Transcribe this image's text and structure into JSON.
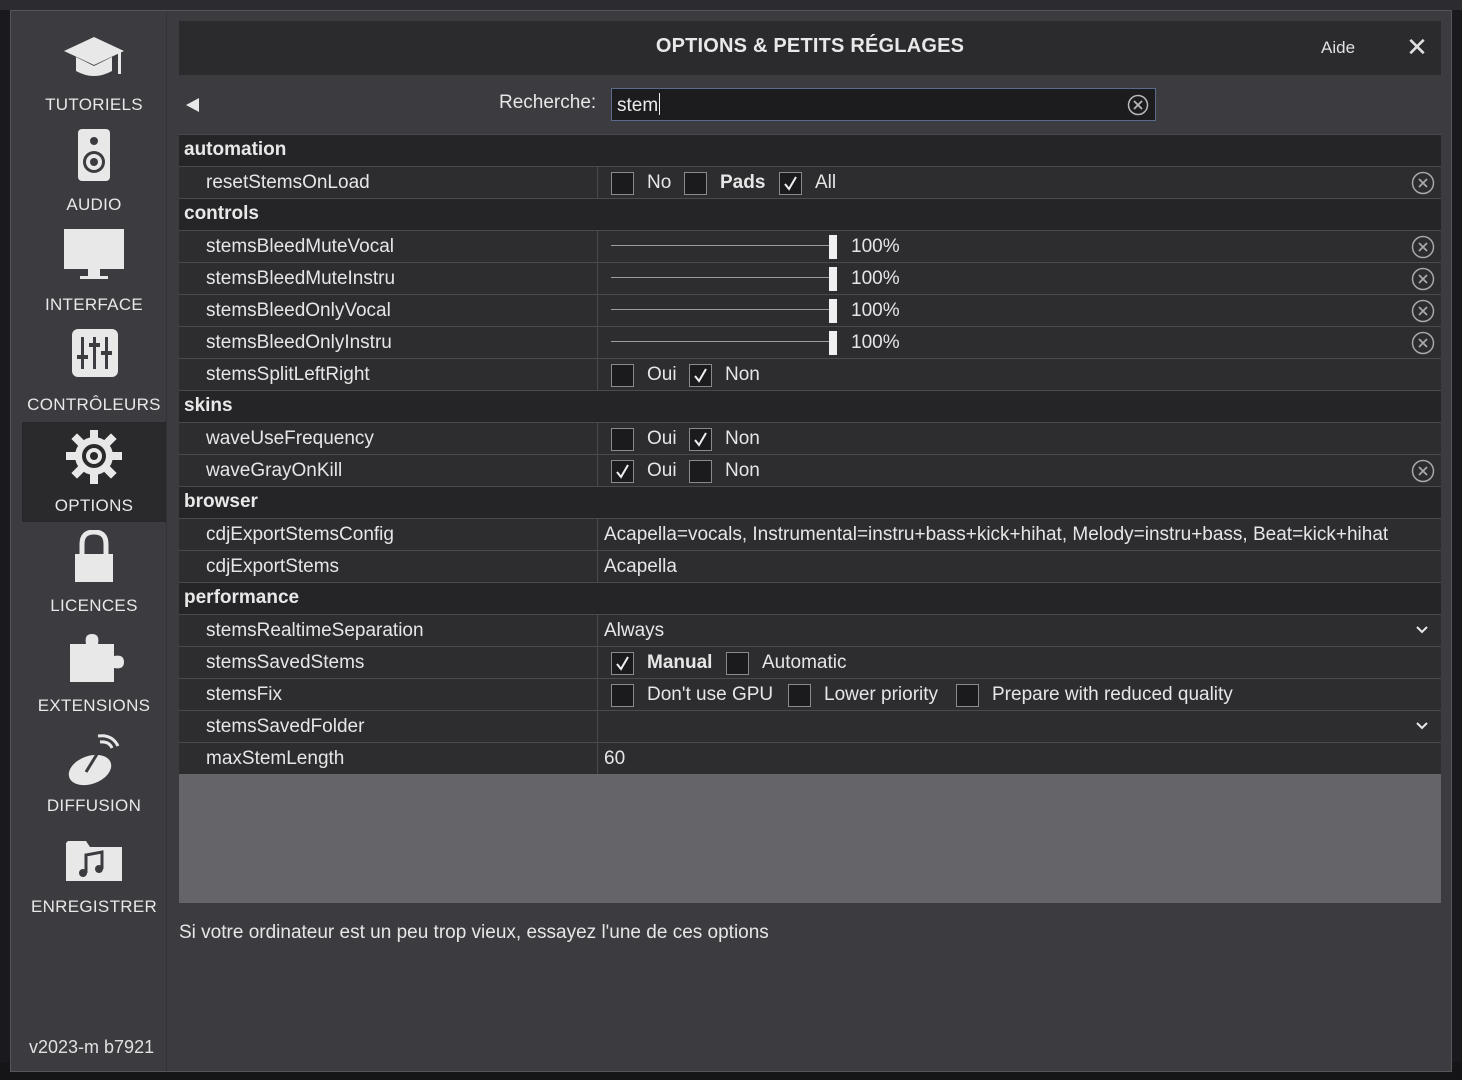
{
  "sidebar": {
    "items": [
      {
        "label": "TUTORIELS",
        "icon": "graduation-cap-icon"
      },
      {
        "label": "AUDIO",
        "icon": "speaker-icon"
      },
      {
        "label": "INTERFACE",
        "icon": "monitor-icon"
      },
      {
        "label": "CONTRÔLEURS",
        "icon": "mixer-sliders-icon"
      },
      {
        "label": "OPTIONS",
        "icon": "gear-icon",
        "active": true
      },
      {
        "label": "LICENCES",
        "icon": "padlock-icon"
      },
      {
        "label": "EXTENSIONS",
        "icon": "puzzle-piece-icon"
      },
      {
        "label": "DIFFUSION",
        "icon": "broadcast-dish-icon"
      },
      {
        "label": "ENREGISTRER",
        "icon": "music-folder-icon"
      }
    ],
    "version": "v2023-m b7921"
  },
  "header": {
    "title": "OPTIONS & PETITS RÉGLAGES",
    "help": "Aide",
    "close": "✕"
  },
  "search": {
    "label": "Recherche:",
    "value": "stem"
  },
  "sections": {
    "automation": {
      "label": "automation",
      "resetStemsOnLoad": {
        "name": "resetStemsOnLoad",
        "opt1": "No",
        "opt2": "Pads",
        "opt3": "All",
        "checked": "All"
      }
    },
    "controls": {
      "label": "controls",
      "stemsBleedMuteVocal": {
        "name": "stemsBleedMuteVocal",
        "value": "100%",
        "level": 1.0
      },
      "stemsBleedMuteInstru": {
        "name": "stemsBleedMuteInstru",
        "value": "100%",
        "level": 1.0
      },
      "stemsBleedOnlyVocal": {
        "name": "stemsBleedOnlyVocal",
        "value": "100%",
        "level": 1.0
      },
      "stemsBleedOnlyInstru": {
        "name": "stemsBleedOnlyInstru",
        "value": "100%",
        "level": 1.0
      },
      "stemsSplitLeftRight": {
        "name": "stemsSplitLeftRight",
        "opt1": "Oui",
        "opt2": "Non",
        "checked": "Non"
      }
    },
    "skins": {
      "label": "skins",
      "waveUseFrequency": {
        "name": "waveUseFrequency",
        "opt1": "Oui",
        "opt2": "Non",
        "checked": "Non"
      },
      "waveGrayOnKill": {
        "name": "waveGrayOnKill",
        "opt1": "Oui",
        "opt2": "Non",
        "checked": "Oui"
      }
    },
    "browser": {
      "label": "browser",
      "cdjExportStemsConfig": {
        "name": "cdjExportStemsConfig",
        "value": "Acapella=vocals, Instrumental=instru+bass+kick+hihat, Melody=instru+bass, Beat=kick+hihat"
      },
      "cdjExportStems": {
        "name": "cdjExportStems",
        "value": "Acapella"
      }
    },
    "performance": {
      "label": "performance",
      "stemsRealtimeSeparation": {
        "name": "stemsRealtimeSeparation",
        "value": "Always"
      },
      "stemsSavedStems": {
        "name": "stemsSavedStems",
        "opt1": "Manual",
        "opt2": "Automatic",
        "checked": "Manual"
      },
      "stemsFix": {
        "name": "stemsFix",
        "opt1": "Don't use GPU",
        "opt2": "Lower priority",
        "opt3": "Prepare with reduced quality"
      },
      "stemsSavedFolder": {
        "name": "stemsSavedFolder",
        "value": ""
      },
      "maxStemLength": {
        "name": "maxStemLength",
        "value": "60"
      }
    }
  },
  "footer": {
    "hint": "Si votre ordinateur est un peu trop vieux, essayez l'une de ces options"
  },
  "colors": {
    "panel": "#3c3c40",
    "row": "#2d2d30",
    "category": "#252528",
    "empty_area": "#656569",
    "search_border": "#5b6a8c"
  }
}
